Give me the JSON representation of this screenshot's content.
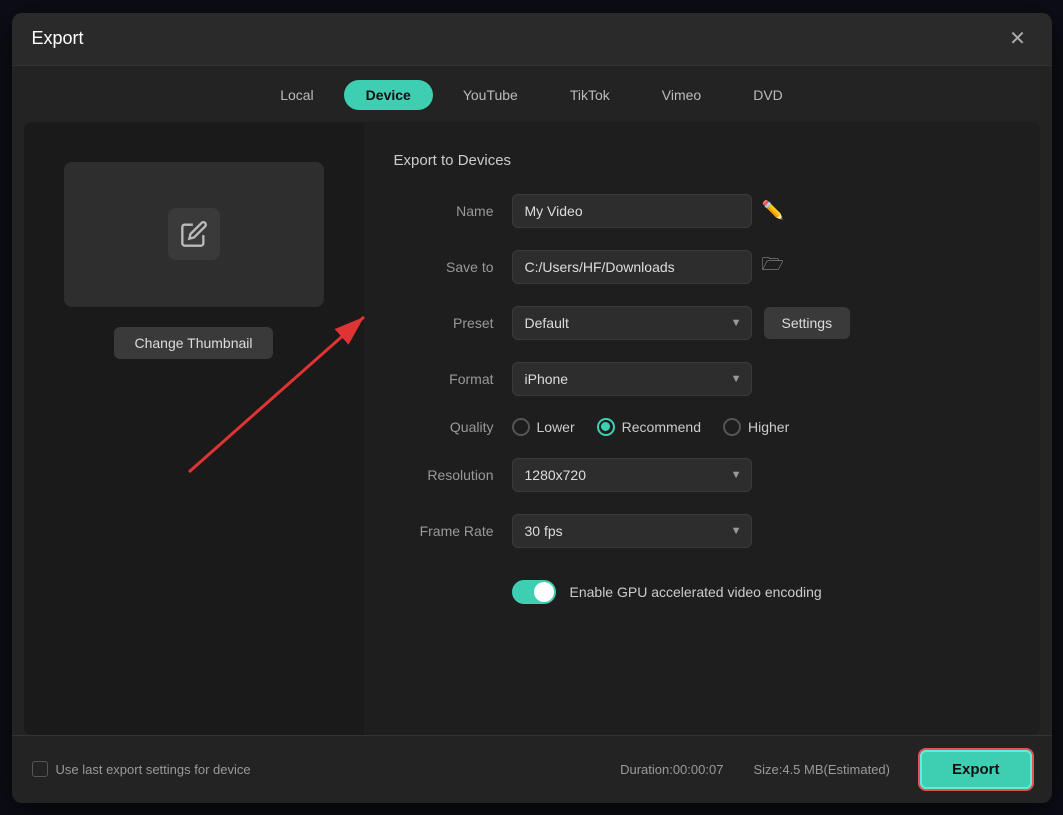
{
  "modal": {
    "title": "Export",
    "close_label": "✕"
  },
  "tabs": [
    {
      "id": "local",
      "label": "Local",
      "active": false
    },
    {
      "id": "device",
      "label": "Device",
      "active": true
    },
    {
      "id": "youtube",
      "label": "YouTube",
      "active": false
    },
    {
      "id": "tiktok",
      "label": "TikTok",
      "active": false
    },
    {
      "id": "vimeo",
      "label": "Vimeo",
      "active": false
    },
    {
      "id": "dvd",
      "label": "DVD",
      "active": false
    }
  ],
  "left_panel": {
    "change_thumbnail_label": "Change Thumbnail"
  },
  "right_panel": {
    "section_title": "Export to Devices",
    "fields": {
      "name_label": "Name",
      "name_value": "My Video",
      "save_to_label": "Save to",
      "save_to_value": "C:/Users/HF/Downloads",
      "preset_label": "Preset",
      "preset_value": "Default",
      "settings_label": "Settings",
      "format_label": "Format",
      "format_value": "iPhone",
      "quality_label": "Quality",
      "quality_options": [
        {
          "id": "lower",
          "label": "Lower",
          "selected": false
        },
        {
          "id": "recommend",
          "label": "Recommend",
          "selected": true
        },
        {
          "id": "higher",
          "label": "Higher",
          "selected": false
        }
      ],
      "resolution_label": "Resolution",
      "resolution_value": "1280x720",
      "frame_rate_label": "Frame Rate",
      "frame_rate_value": "30 fps",
      "gpu_label": "Enable GPU accelerated video encoding",
      "gpu_enabled": true
    }
  },
  "footer": {
    "checkbox_label": "Use last export settings for device",
    "duration_label": "Duration:00:00:07",
    "size_label": "Size:4.5 MB(Estimated)",
    "export_label": "Export"
  },
  "colors": {
    "accent": "#3ecfb2",
    "danger": "#e05555"
  }
}
